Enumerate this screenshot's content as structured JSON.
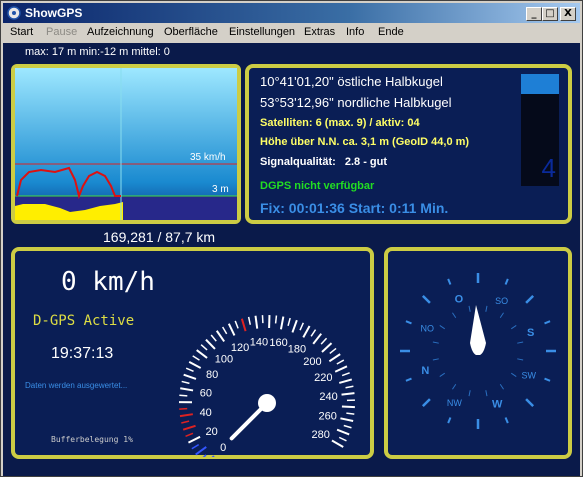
{
  "window": {
    "title": "ShowGPS",
    "min_label": "_",
    "max_label": "□",
    "close_label": "X"
  },
  "menu": [
    "Start",
    "Pause",
    "Aufzeichnung",
    "Oberfläche",
    "Einstellungen",
    "Extras",
    "Info",
    "Ende"
  ],
  "menu_disabled_index": 1,
  "header": {
    "stats": "max: 17 m min:-12 m mittel: 0"
  },
  "graph": {
    "speed_marker": "35 km/h",
    "alt_marker": "3 m",
    "distance": "169,281 / 87,7 km"
  },
  "position": {
    "longitude": "10°41'01,20\" östliche Halbkugel",
    "latitude": "53°53'12,96\" nordliche Halbkugel",
    "satellites": "Satelliten: 6 (max. 9) / aktiv: 04",
    "altitude": "Höhe über N.N. ca. 3,1 m (GeoID 44,0 m)",
    "signal_label": "Signalqualität:",
    "signal_value": "2.8 - gut",
    "dgps_status": "DGPS nicht verfügbar",
    "fix": "Fix: 00:01:36 Start: 0:11 Min.",
    "satellite_count": "4",
    "signal_level": 0.15
  },
  "speed": {
    "value": "0 km/h",
    "dgps_mode": "D-GPS Active",
    "time": "19:37:13",
    "processing": "Daten werden ausgewertet...",
    "buffer": "Bufferbelegung  1%",
    "speedometer_labels": [
      "0",
      "20",
      "40",
      "60",
      "80",
      "100",
      "120",
      "140",
      "160",
      "180",
      "200",
      "220",
      "240",
      "260",
      "280"
    ],
    "needle_speed": 0
  },
  "compass": {
    "labels": [
      "O",
      "SO",
      "S",
      "SW",
      "W",
      "NW",
      "N",
      "NO"
    ],
    "heading_deg": 0
  },
  "colors": {
    "panel_border": "#cccc44",
    "panel_bg": "#0a1e55",
    "accent_blue": "#3a8ee6",
    "yellow": "#ffff66",
    "green": "#22dd22"
  }
}
